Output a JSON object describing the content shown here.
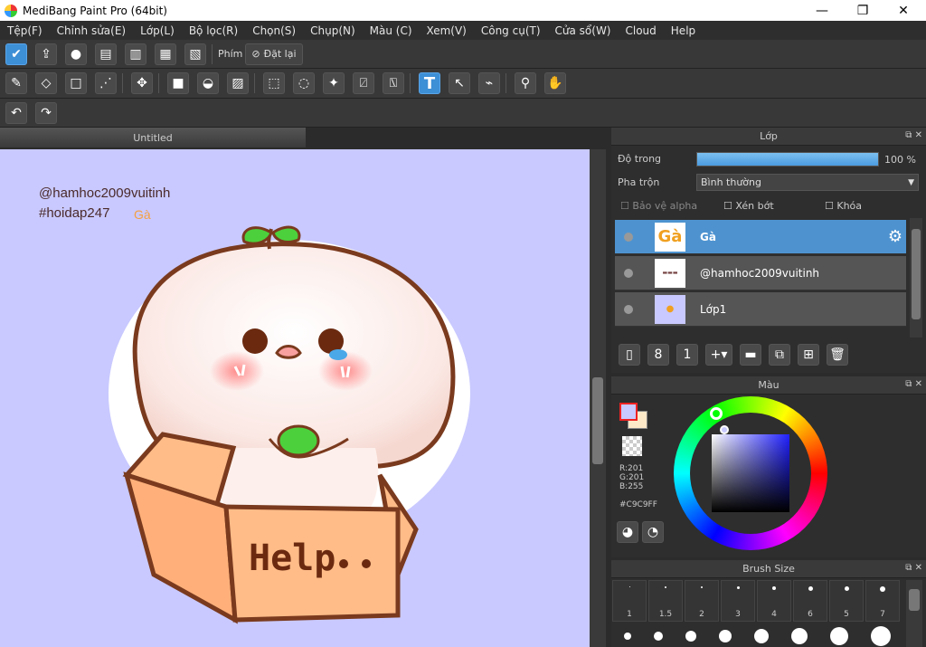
{
  "window": {
    "title": "MediBang Paint Pro (64bit)",
    "minimize": "—",
    "maximize": "❐",
    "close": "✕"
  },
  "menu": [
    "Tệp(F)",
    "Chỉnh sửa(E)",
    "Lớp(L)",
    "Bộ lọc(R)",
    "Chọn(S)",
    "Chụp(N)",
    "Màu (C)",
    "Xem(V)",
    "Công cụ(T)",
    "Cửa sổ(W)",
    "Cloud",
    "Help"
  ],
  "toolbar1": {
    "phim_label": "Phím",
    "reset_label": "Đặt lại"
  },
  "document": {
    "tab": "Untitled"
  },
  "canvas": {
    "line1": "@hamhoc2009vuitinh",
    "line2": "#hoidap247",
    "line3": "Gà",
    "box_text": "Help"
  },
  "layer_panel": {
    "title": "Lớp",
    "opacity_label": "Độ trong",
    "opacity_value": "100 %",
    "opacity_fraction": 1.0,
    "blend_label": "Pha trộn",
    "blend_value": "Bình thường",
    "protect_alpha": "Bảo vệ alpha",
    "clipping": "Xén bớt",
    "lock": "Khóa",
    "layers": [
      {
        "name": "Gà",
        "selected": true
      },
      {
        "name": "@hamhoc2009vuitinh",
        "selected": false
      },
      {
        "name": "Lớp1",
        "selected": false
      }
    ]
  },
  "color_panel": {
    "title": "Màu",
    "r": "R:201",
    "g": "G:201",
    "b": "B:255",
    "hex": "#C9C9FF",
    "fg": "#C9C9FF"
  },
  "brush_panel": {
    "title": "Brush Size",
    "sizes": [
      "1",
      "1.5",
      "2",
      "3",
      "4",
      "6",
      "5",
      "7"
    ]
  },
  "colors": {
    "accent": "#3d8fd6",
    "canvas_bg": "#C9C9FF"
  }
}
